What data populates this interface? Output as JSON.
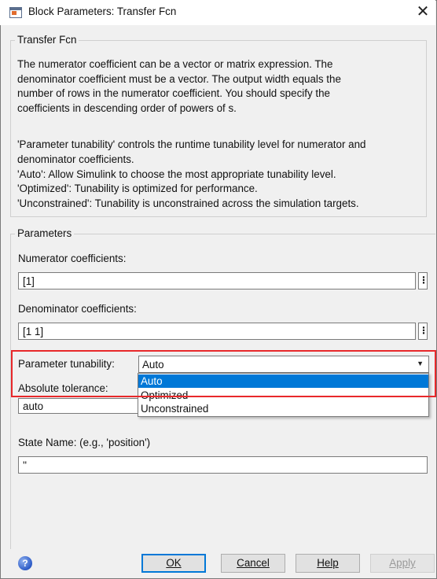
{
  "window": {
    "title": "Block Parameters: Transfer Fcn",
    "close_glyph": "✕"
  },
  "block_group": {
    "label": "Transfer Fcn",
    "description_lines": [
      "The numerator coefficient can be a vector or matrix expression. The",
      "denominator coefficient must be a vector. The output width equals the",
      "number of rows in the numerator coefficient. You should specify the",
      "coefficients in descending order of powers of s.",
      "",
      "'Parameter tunability' controls the runtime tunability level for numerator and",
      "denominator coefficients.",
      "'Auto': Allow Simulink to choose the most appropriate tunability level.",
      "'Optimized': Tunability is optimized for performance.",
      "'Unconstrained': Tunability is unconstrained across the simulation targets."
    ]
  },
  "parameters": {
    "label": "Parameters",
    "numerator": {
      "label": "Numerator coefficients:",
      "value": "[1]",
      "more": "⋮"
    },
    "denominator": {
      "label": "Denominator coefficients:",
      "value": "[1 1]",
      "more": "⋮"
    },
    "tunability": {
      "label": "Parameter tunability:",
      "selected": "Auto",
      "chevron": "▼",
      "options": [
        "Auto",
        "Optimized",
        "Unconstrained"
      ],
      "highlight_color": "#e8282a"
    },
    "absolute_tolerance": {
      "label": "Absolute tolerance:",
      "value": "auto"
    },
    "state_name": {
      "label": "State Name: (e.g., 'position')",
      "value": "''"
    }
  },
  "footer": {
    "help_icon": "?",
    "ok": "OK",
    "cancel": "Cancel",
    "help": "Help",
    "apply": "Apply"
  },
  "colors": {
    "accent": "#0078d7",
    "window_bg": "#f0f0f0"
  }
}
